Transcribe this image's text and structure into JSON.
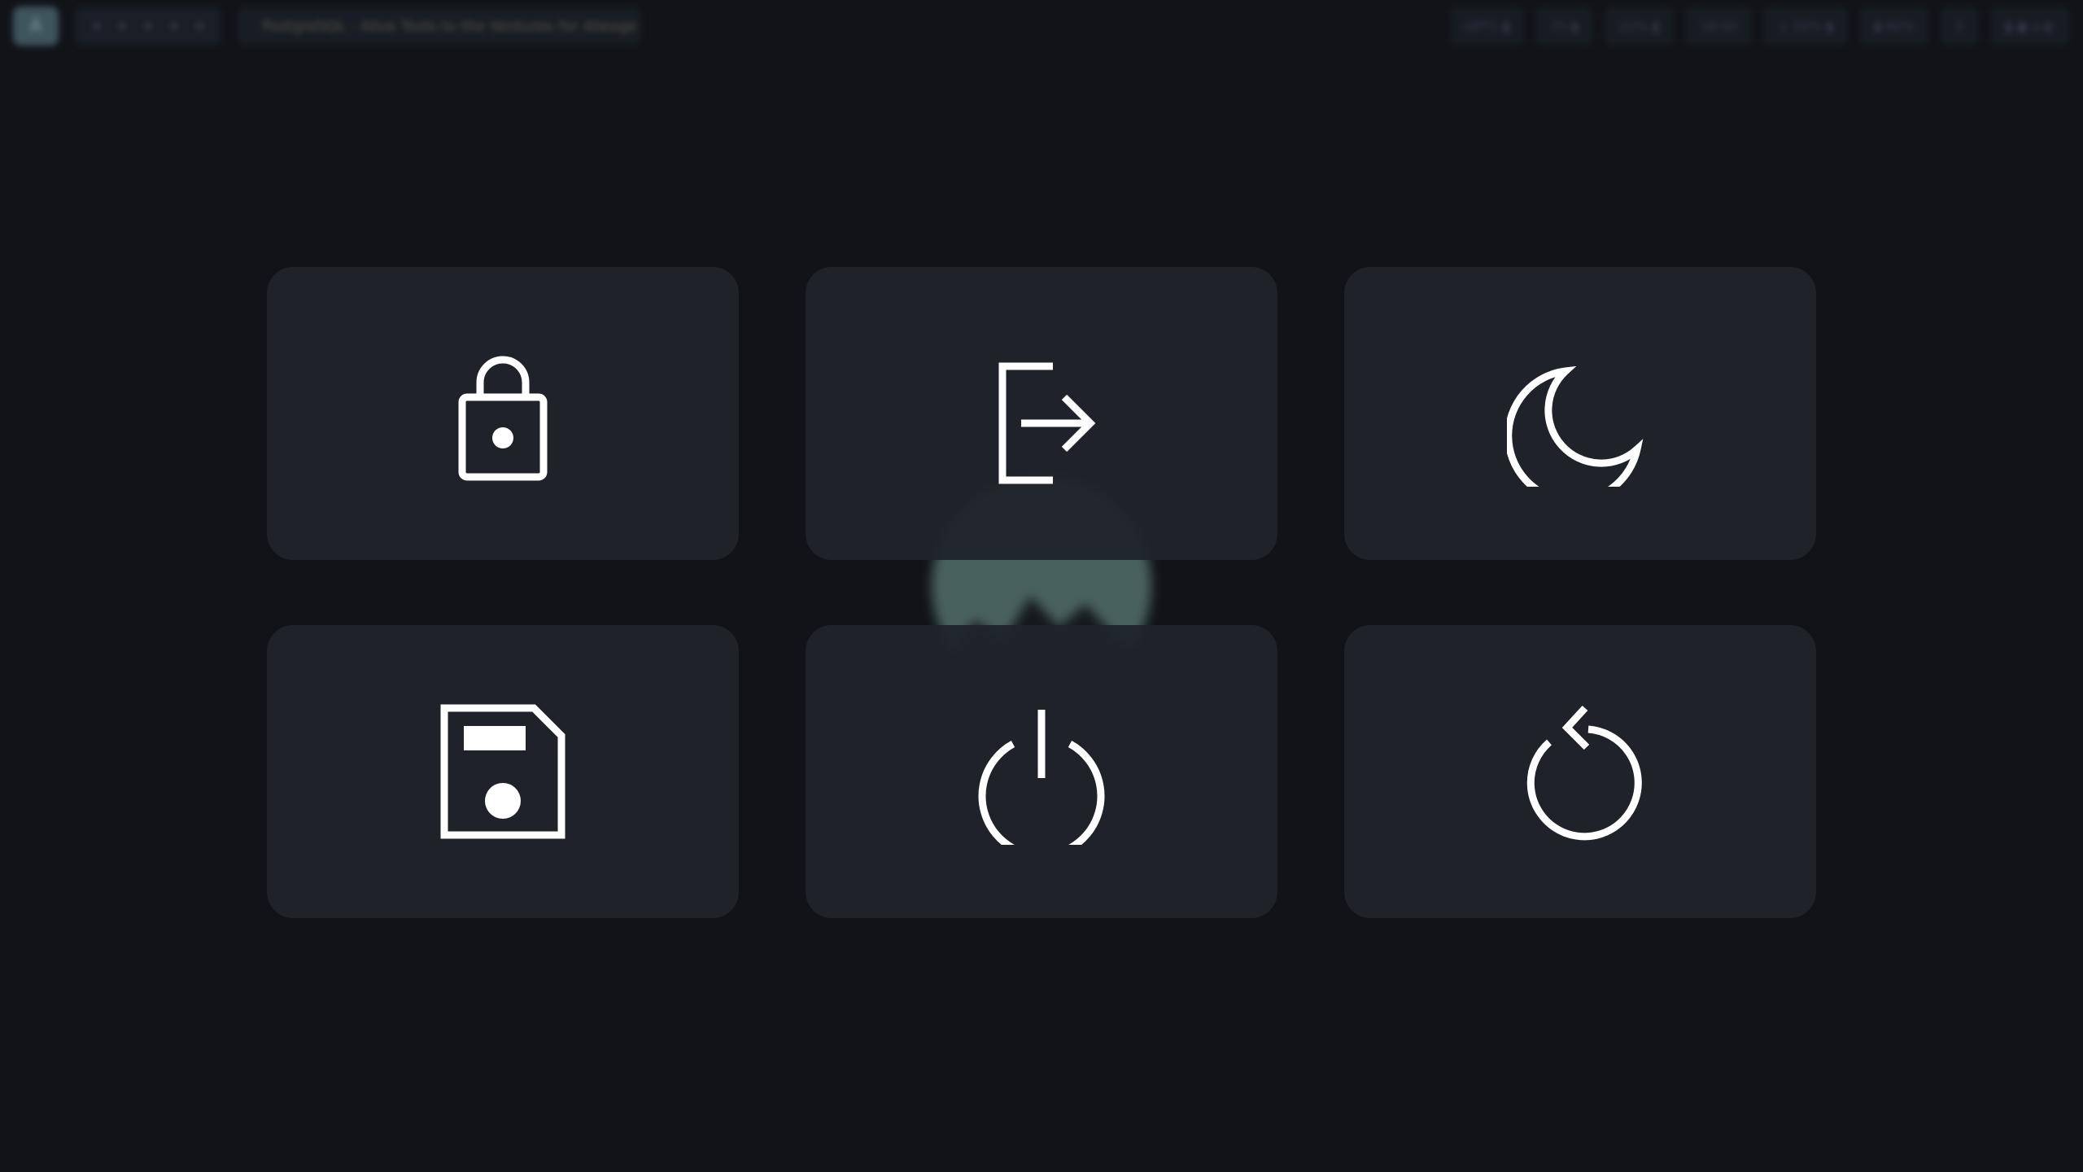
{
  "topbar": {
    "logo_glyph": "A",
    "title": "PostgreSQL - Alive Tools to the Ventures for Alwage Mu...",
    "chips": [
      "GPT1 ▮",
      "75 ▮",
      "22% ▮",
      "18:00",
      "↓ 50% ▮",
      "▮ 80%",
      "⚲",
      "▮ ● ⌀ ◐"
    ]
  },
  "actions": [
    {
      "id": "lock",
      "label": "Lock",
      "icon": "lock-icon"
    },
    {
      "id": "logout",
      "label": "Log out",
      "icon": "logout-icon"
    },
    {
      "id": "suspend",
      "label": "Suspend",
      "icon": "moon-icon"
    },
    {
      "id": "hibernate",
      "label": "Hibernate",
      "icon": "floppy-disk-icon"
    },
    {
      "id": "shutdown",
      "label": "Shut down",
      "icon": "power-icon"
    },
    {
      "id": "reboot",
      "label": "Reboot",
      "icon": "reboot-icon"
    }
  ],
  "colors": {
    "background": "#111318",
    "tile": "#20232b",
    "icon": "#ffffff",
    "accent": "#4c6660"
  }
}
